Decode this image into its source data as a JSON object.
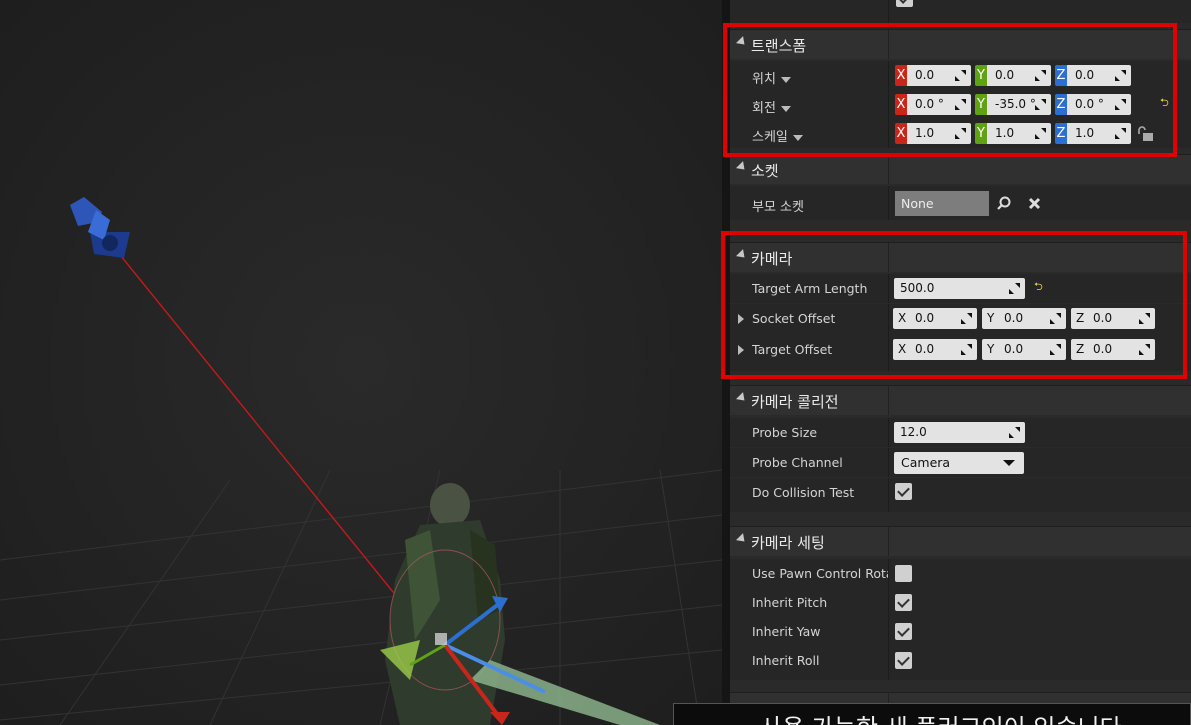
{
  "details": {
    "transform": {
      "title": "트랜스폼",
      "location_label": "위치",
      "rotation_label": "회전",
      "scale_label": "스케일",
      "location": {
        "x": "0.0",
        "y": "0.0",
        "z": "0.0"
      },
      "rotation": {
        "x": "0.0 °",
        "y": "-35.0 °",
        "z": "0.0 °"
      },
      "scale": {
        "x": "1.0",
        "y": "1.0",
        "z": "1.0"
      }
    },
    "socket": {
      "title": "소켓",
      "parent_socket_label": "부모 소켓",
      "parent_socket_value": "None"
    },
    "camera": {
      "title": "카메라",
      "target_arm_length_label": "Target Arm Length",
      "target_arm_length_value": "500.0",
      "socket_offset_label": "Socket Offset",
      "socket_offset": {
        "x": "0.0",
        "y": "0.0",
        "z": "0.0"
      },
      "target_offset_label": "Target Offset",
      "target_offset": {
        "x": "0.0",
        "y": "0.0",
        "z": "0.0"
      }
    },
    "camera_collision": {
      "title": "카메라 콜리전",
      "probe_size_label": "Probe Size",
      "probe_size_value": "12.0",
      "probe_channel_label": "Probe Channel",
      "probe_channel_value": "Camera",
      "do_collision_test_label": "Do Collision Test",
      "do_collision_test": true
    },
    "camera_settings": {
      "title": "카메라 세팅",
      "use_pawn_control_rotation_label": "Use Pawn Control Rotati",
      "use_pawn_control_rotation": false,
      "inherit_pitch_label": "Inherit Pitch",
      "inherit_pitch": true,
      "inherit_yaw_label": "Inherit Yaw",
      "inherit_yaw": true,
      "inherit_roll_label": "Inherit Roll",
      "inherit_roll": true
    },
    "axis_labels": {
      "x": "X",
      "y": "Y",
      "z": "Z"
    }
  },
  "toast": {
    "message": "사용 가능한 새 플러그인이 있습니다"
  },
  "colors": {
    "highlight": "#e00000",
    "axis_x": "#c8261b",
    "axis_y": "#5fa314",
    "axis_z": "#2c6fd1",
    "reset_arrow": "#e8d44a"
  },
  "icons": [
    "search-icon",
    "clear-icon",
    "lock-icon",
    "reset-icon",
    "dropdown-arrow-icon",
    "checkmark-icon",
    "expand-arrow-icon",
    "collapse-arrow-icon",
    "camera-icon",
    "gizmo-icon"
  ]
}
